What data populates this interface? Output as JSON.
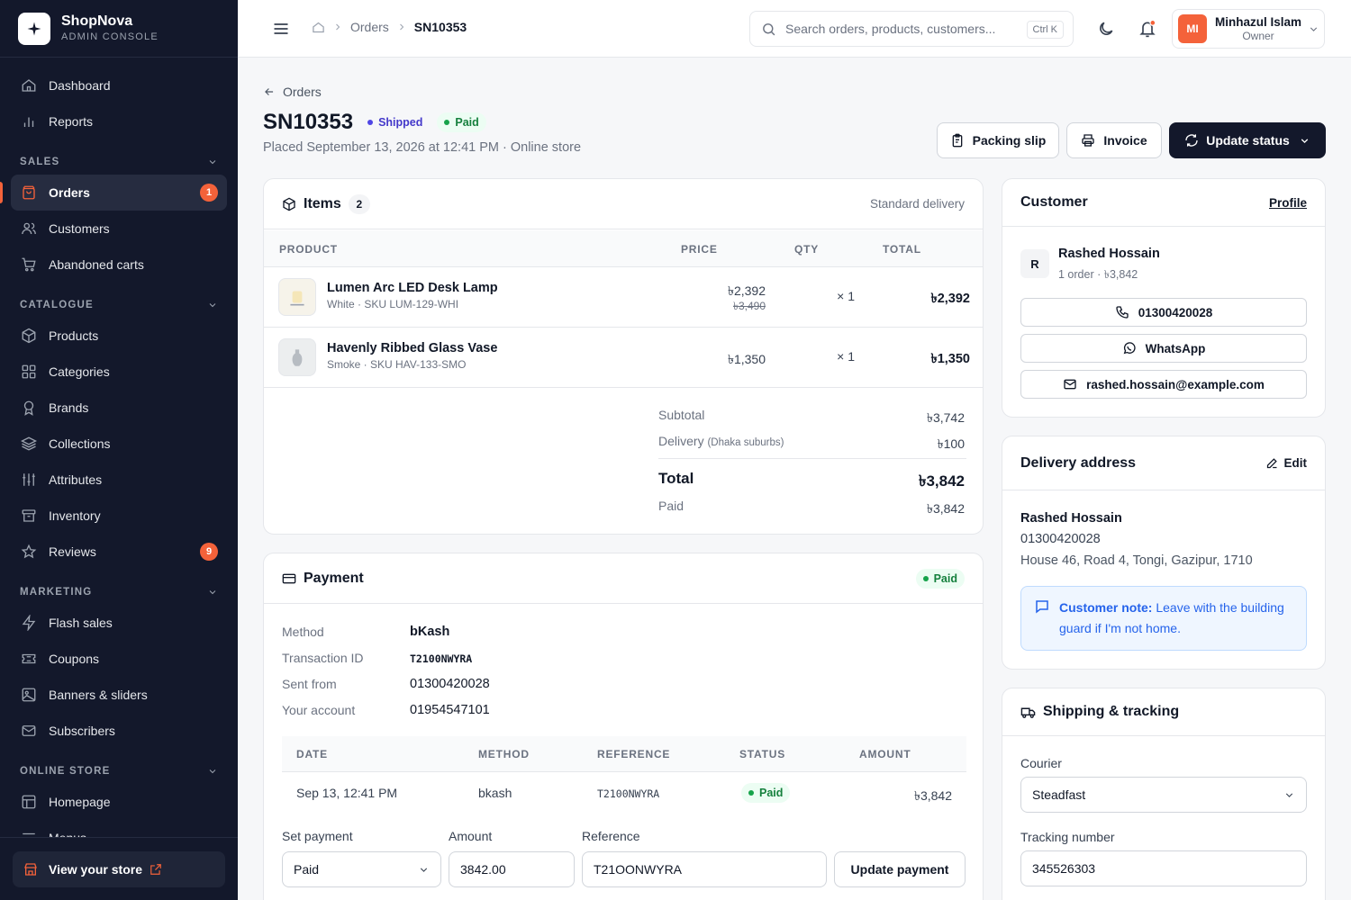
{
  "brand": {
    "name": "ShopNova",
    "subtitle": "ADMIN CONSOLE"
  },
  "sidebar": {
    "items_top": [
      {
        "label": "Dashboard",
        "icon": "home-icon"
      },
      {
        "label": "Reports",
        "icon": "bar-chart-icon"
      }
    ],
    "sections": [
      {
        "title": "SALES",
        "items": [
          {
            "label": "Orders",
            "icon": "shopping-bag-icon",
            "badge": "1",
            "active": true
          },
          {
            "label": "Customers",
            "icon": "users-icon"
          },
          {
            "label": "Abandoned carts",
            "icon": "cart-icon"
          }
        ]
      },
      {
        "title": "CATALOGUE",
        "items": [
          {
            "label": "Products",
            "icon": "box-icon"
          },
          {
            "label": "Categories",
            "icon": "grid-icon"
          },
          {
            "label": "Brands",
            "icon": "award-icon"
          },
          {
            "label": "Collections",
            "icon": "layers-icon"
          },
          {
            "label": "Attributes",
            "icon": "sliders-icon"
          },
          {
            "label": "Inventory",
            "icon": "archive-icon"
          },
          {
            "label": "Reviews",
            "icon": "star-icon",
            "badge": "9"
          }
        ]
      },
      {
        "title": "MARKETING",
        "items": [
          {
            "label": "Flash sales",
            "icon": "zap-icon"
          },
          {
            "label": "Coupons",
            "icon": "ticket-icon"
          },
          {
            "label": "Banners & sliders",
            "icon": "image-icon"
          },
          {
            "label": "Subscribers",
            "icon": "mail-icon"
          }
        ]
      },
      {
        "title": "ONLINE STORE",
        "items": [
          {
            "label": "Homepage",
            "icon": "layout-icon"
          },
          {
            "label": "Menus",
            "icon": "menu-icon"
          }
        ]
      }
    ],
    "view_store": "View your store"
  },
  "topbar": {
    "breadcrumb": [
      "Orders",
      "SN10353"
    ],
    "search_placeholder": "Search orders, products, customers...",
    "search_shortcut": "Ctrl K",
    "user": {
      "initials": "MI",
      "name": "Minhazul Islam",
      "role": "Owner"
    }
  },
  "order": {
    "back_label": "Orders",
    "id": "SN10353",
    "status": "Shipped",
    "payment_status": "Paid",
    "placed": "Placed September 13, 2026 at 12:41 PM · Online store",
    "buttons": {
      "packing_slip": "Packing slip",
      "invoice": "Invoice",
      "update_status": "Update status"
    }
  },
  "items_card": {
    "title": "Items",
    "count": "2",
    "delivery_type": "Standard delivery",
    "columns": [
      "PRODUCT",
      "PRICE",
      "QTY",
      "TOTAL"
    ],
    "rows": [
      {
        "name": "Lumen Arc LED Desk Lamp",
        "meta": "White · SKU LUM-129-WHI",
        "price": "৳2,392",
        "original_price": "৳3,490",
        "qty": "× 1",
        "total": "৳2,392"
      },
      {
        "name": "Havenly Ribbed Glass Vase",
        "meta": "Smoke · SKU HAV-133-SMO",
        "price": "৳1,350",
        "original_price": "",
        "qty": "× 1",
        "total": "৳1,350"
      }
    ],
    "summary": {
      "subtotal_label": "Subtotal",
      "subtotal": "৳3,742",
      "delivery_label": "Delivery",
      "delivery_note": "(Dhaka suburbs)",
      "delivery": "৳100",
      "total_label": "Total",
      "total": "৳3,842",
      "paid_label": "Paid",
      "paid": "৳3,842"
    }
  },
  "payment_card": {
    "title": "Payment",
    "status": "Paid",
    "details": [
      {
        "label": "Method",
        "value": "bKash"
      },
      {
        "label": "Transaction ID",
        "value": "T2100NWYRA"
      },
      {
        "label": "Sent from",
        "value": "01300420028"
      },
      {
        "label": "Your account",
        "value": "01954547101"
      }
    ],
    "columns": [
      "DATE",
      "METHOD",
      "REFERENCE",
      "STATUS",
      "AMOUNT"
    ],
    "rows": [
      {
        "date": "Sep 13, 12:41 PM",
        "method": "bkash",
        "reference": "T2100NWYRA",
        "status": "Paid",
        "amount": "৳3,842"
      }
    ],
    "form": {
      "set_payment_label": "Set payment",
      "set_payment_value": "Paid",
      "amount_label": "Amount",
      "amount_value": "3842.00",
      "reference_label": "Reference",
      "reference_value": "T21OONWYRA",
      "submit": "Update payment"
    }
  },
  "customer_card": {
    "title": "Customer",
    "profile_link": "Profile",
    "initial": "R",
    "name": "Rashed Hossain",
    "meta": "1 order · ৳3,842",
    "phone": "01300420028",
    "whatsapp": "WhatsApp",
    "email": "rashed.hossain@example.com"
  },
  "address_card": {
    "title": "Delivery address",
    "edit": "Edit",
    "name": "Rashed Hossain",
    "phone": "01300420028",
    "address": "House 46, Road 4, Tongi, Gazipur, 1710",
    "note_label": "Customer note:",
    "note_text": "Leave with the building guard if I'm not home."
  },
  "shipping_card": {
    "title": "Shipping & tracking",
    "courier_label": "Courier",
    "courier_value": "Steadfast",
    "tracking_label": "Tracking number",
    "tracking_value": "345526303"
  },
  "colors": {
    "accent": "#f4623a",
    "sidebar_bg": "#13182b",
    "primary_button": "#13182b",
    "shipped": "#4338ca",
    "paid": "#15803d"
  }
}
